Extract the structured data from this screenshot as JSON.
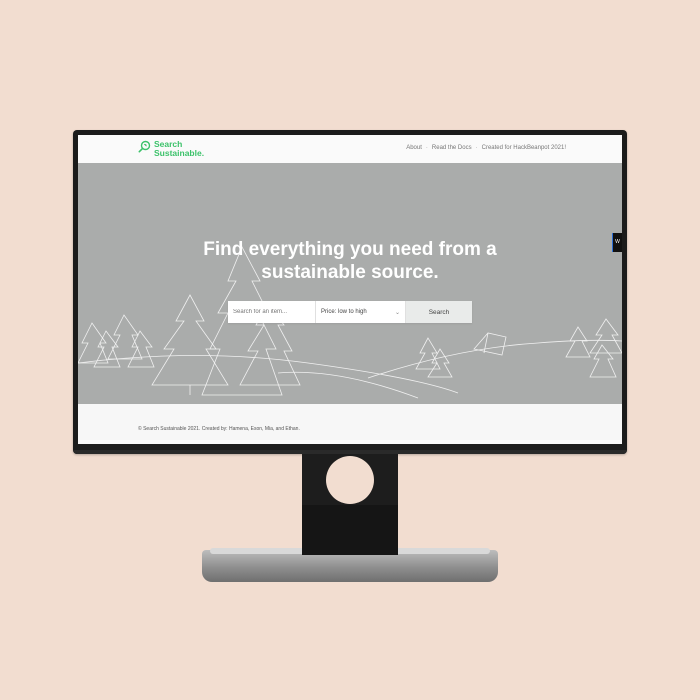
{
  "brand": {
    "line1": "Search",
    "line2": "Sustainable.",
    "color": "#3cc26a"
  },
  "nav": {
    "items": [
      "About",
      "Read the Docs",
      "Created for HackBeanpot 2021!"
    ],
    "separator": "·"
  },
  "hero": {
    "headline_line1": "Find everything you need from a",
    "headline_line2": "sustainable source.",
    "background_color": "#aaacab"
  },
  "search": {
    "placeholder": "Search for an item...",
    "sort_selected": "Price: low to high",
    "button_label": "Search"
  },
  "side_tab": {
    "label": "W"
  },
  "footer": {
    "text": "© Search Sustainable 2021. Created by: Hamena, Eson, Mia, and Ethan."
  }
}
